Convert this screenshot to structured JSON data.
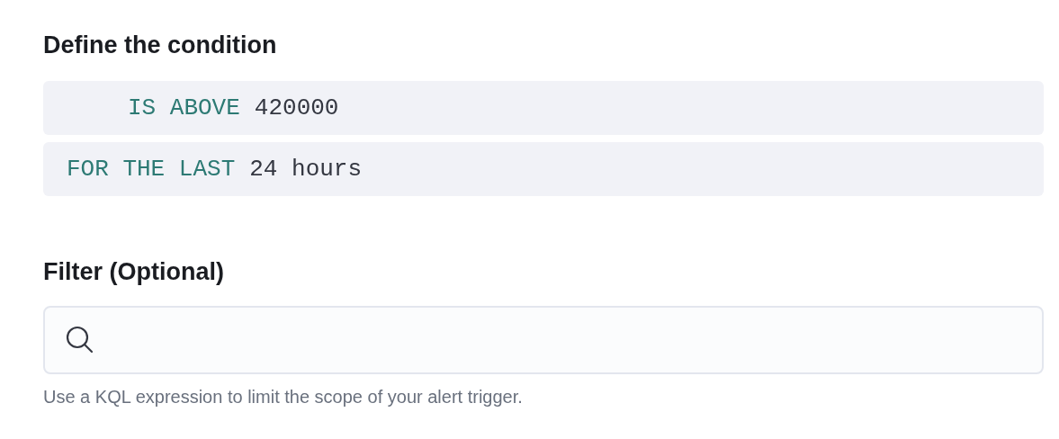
{
  "condition": {
    "title": "Define the condition",
    "expressions": [
      {
        "indented": true,
        "keyword": "IS ABOVE",
        "value": "420000"
      },
      {
        "indented": false,
        "keyword": "FOR THE LAST",
        "value": "24 hours"
      }
    ]
  },
  "filter": {
    "title": "Filter (Optional)",
    "help": "Use a KQL expression to limit the scope of your alert trigger."
  }
}
